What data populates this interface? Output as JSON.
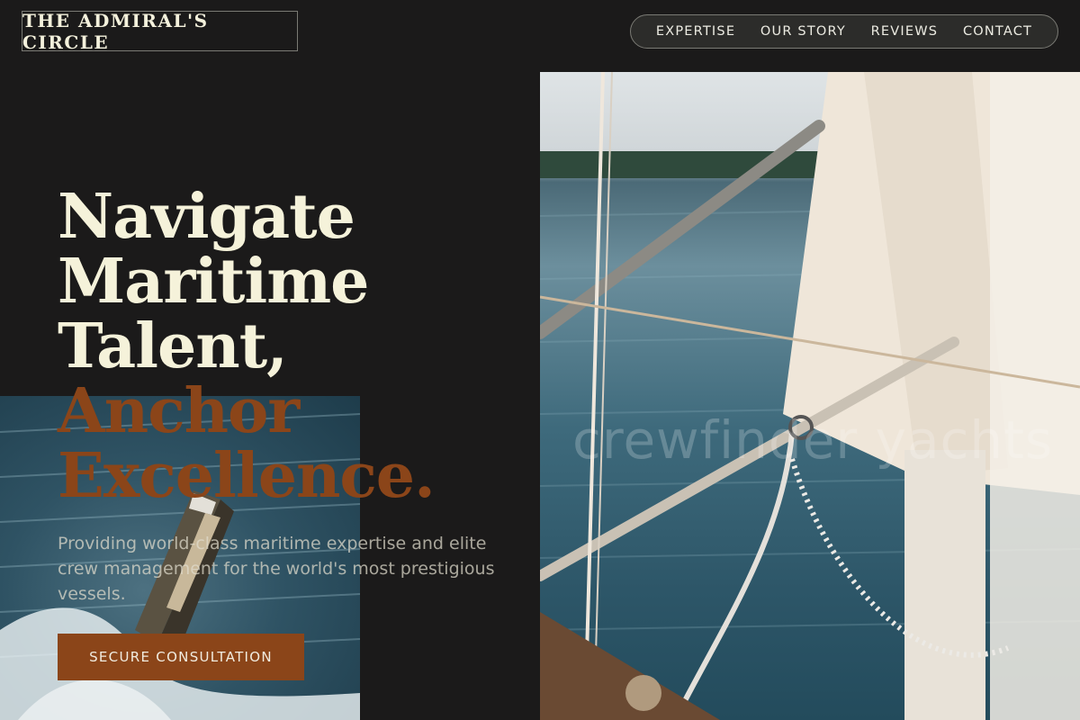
{
  "header": {
    "logo": "THE ADMIRAL'S CIRCLE",
    "nav": [
      {
        "label": "EXPERTISE"
      },
      {
        "label": "OUR STORY"
      },
      {
        "label": "REVIEWS"
      },
      {
        "label": "CONTACT"
      }
    ]
  },
  "hero": {
    "headline_lines": [
      "Navigate",
      "Maritime",
      "Talent,"
    ],
    "accent_lines": [
      "Anchor",
      "Excellence."
    ],
    "subtext": "Providing world-class maritime expertise and elite crew management for the world's most prestigious vessels.",
    "cta_label": "SECURE CONSULTATION",
    "watermark": "crewfinder yachts"
  },
  "colors": {
    "background": "#1b1a1a",
    "headline": "#f5f2da",
    "accent": "#8b4519",
    "cta_background": "#8b4519"
  },
  "images": {
    "hero": "sailboat-rigging-photo",
    "secondary": "motor-yacht-wake-photo"
  }
}
